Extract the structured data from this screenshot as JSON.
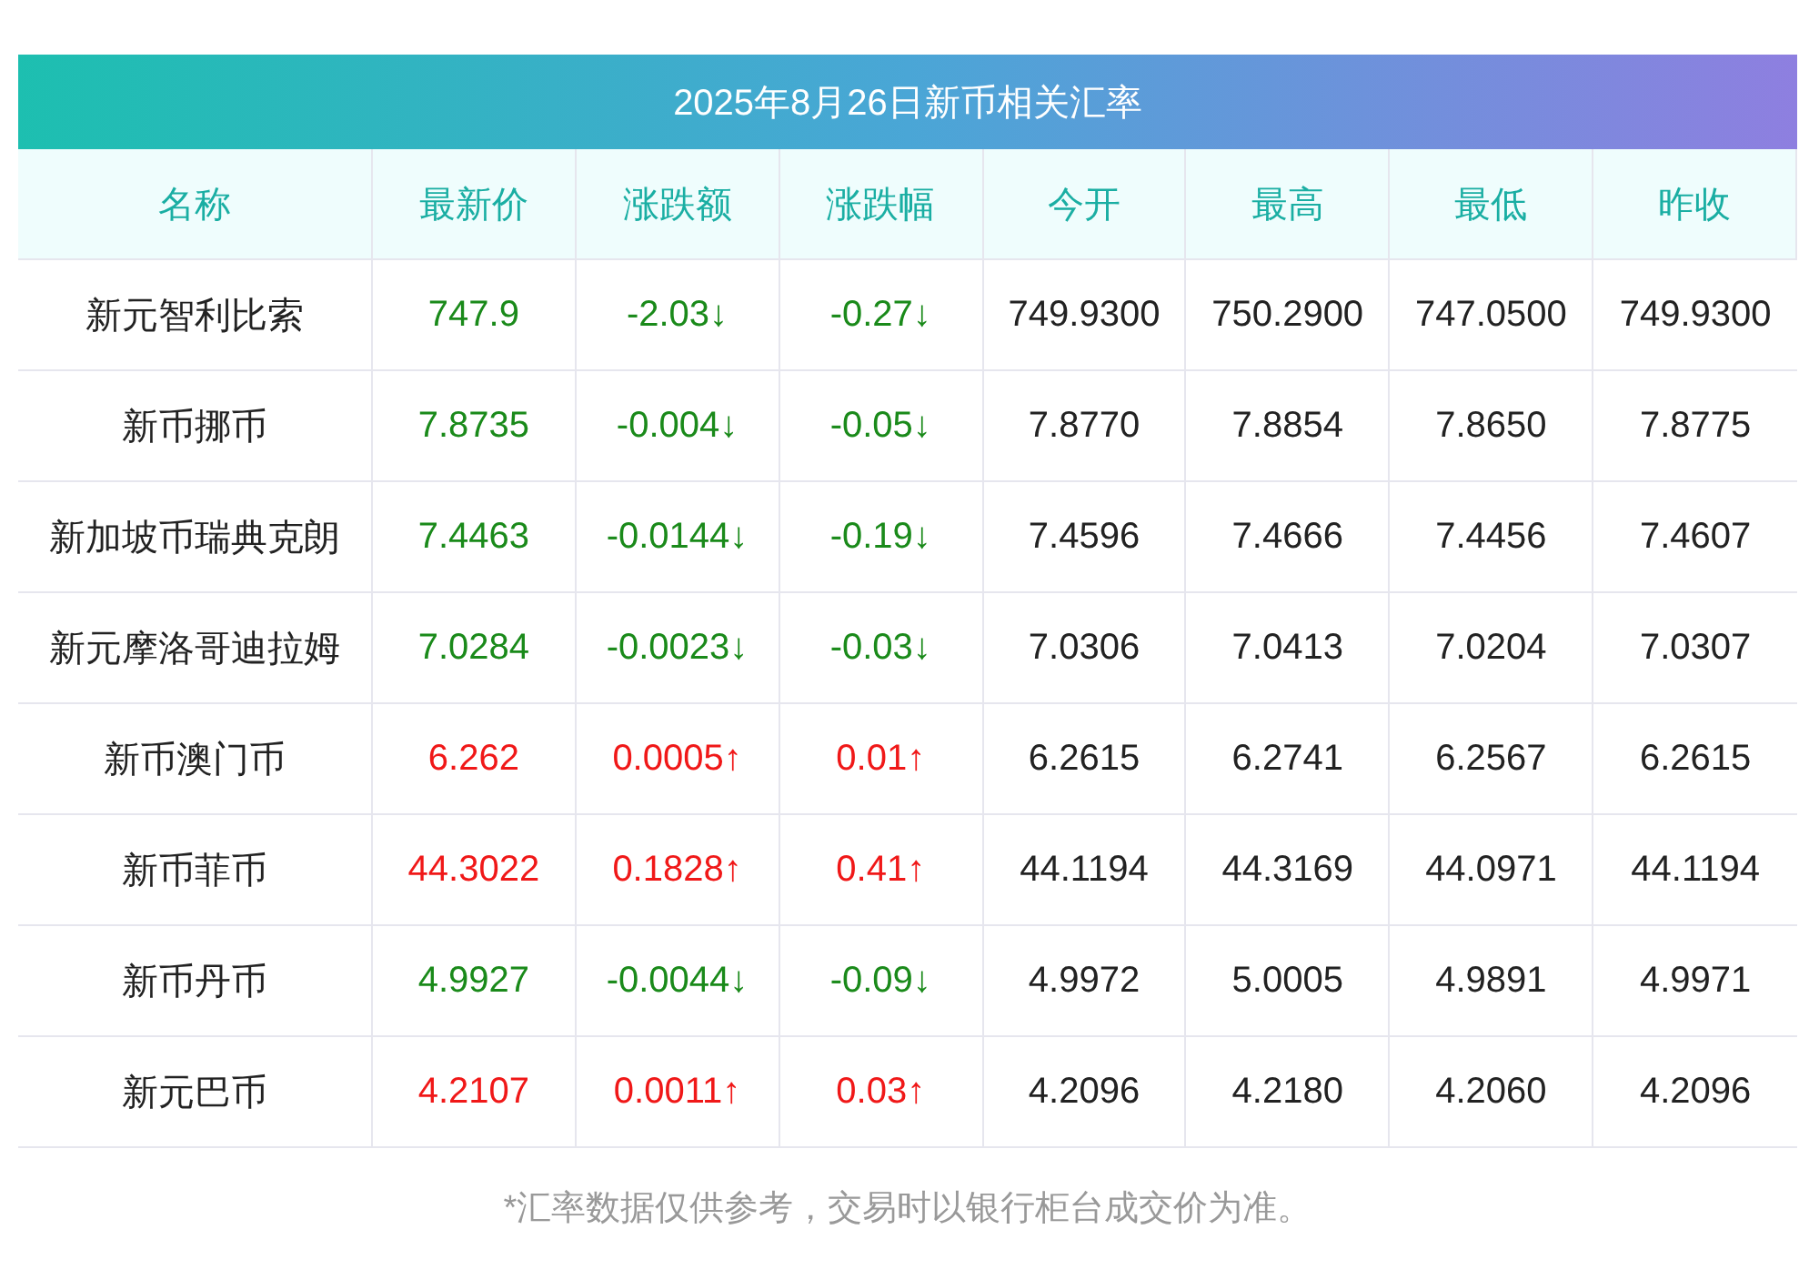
{
  "title": "2025年8月26日新币相关汇率",
  "columns": [
    "名称",
    "最新价",
    "涨跌额",
    "涨跌幅",
    "今开",
    "最高",
    "最低",
    "昨收"
  ],
  "rows": [
    {
      "rising": false,
      "cells": [
        "新元智利比索",
        "747.9",
        "-2.03↓",
        "-0.27↓",
        "749.9300",
        "750.2900",
        "747.0500",
        "749.9300"
      ]
    },
    {
      "rising": false,
      "cells": [
        "新币挪币",
        "7.8735",
        "-0.004↓",
        "-0.05↓",
        "7.8770",
        "7.8854",
        "7.8650",
        "7.8775"
      ]
    },
    {
      "rising": false,
      "cells": [
        "新加坡币瑞典克朗",
        "7.4463",
        "-0.0144↓",
        "-0.19↓",
        "7.4596",
        "7.4666",
        "7.4456",
        "7.4607"
      ]
    },
    {
      "rising": false,
      "cells": [
        "新元摩洛哥迪拉姆",
        "7.0284",
        "-0.0023↓",
        "-0.03↓",
        "7.0306",
        "7.0413",
        "7.0204",
        "7.0307"
      ]
    },
    {
      "rising": true,
      "cells": [
        "新币澳门币",
        "6.262",
        "0.0005↑",
        "0.01↑",
        "6.2615",
        "6.2741",
        "6.2567",
        "6.2615"
      ]
    },
    {
      "rising": true,
      "cells": [
        "新币菲币",
        "44.3022",
        "0.1828↑",
        "0.41↑",
        "44.1194",
        "44.3169",
        "44.0971",
        "44.1194"
      ]
    },
    {
      "rising": false,
      "cells": [
        "新币丹币",
        "4.9927",
        "-0.0044↓",
        "-0.09↓",
        "4.9972",
        "5.0005",
        "4.9891",
        "4.9971"
      ]
    },
    {
      "rising": true,
      "cells": [
        "新元巴币",
        "4.2107",
        "0.0011↑",
        "0.03↑",
        "4.2096",
        "4.2180",
        "4.2060",
        "4.2096"
      ]
    }
  ],
  "note": "*汇率数据仅供参考，交易时以银行柜台成交价为准。"
}
